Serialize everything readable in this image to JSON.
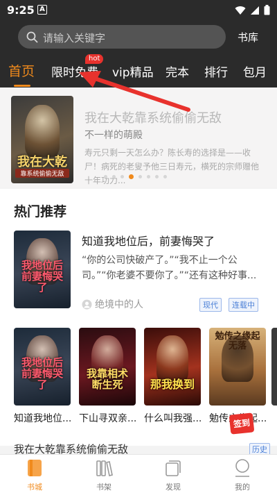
{
  "status_bar": {
    "time": "9:25",
    "badge": "A"
  },
  "search": {
    "placeholder": "请输入关键字",
    "shelf_link": "书库"
  },
  "tabs": [
    {
      "label": "首页",
      "active": true
    },
    {
      "label": "限时免费",
      "badge": "hot"
    },
    {
      "label": "vip精品"
    },
    {
      "label": "完本"
    },
    {
      "label": "排行"
    },
    {
      "label": "包月"
    }
  ],
  "banner": {
    "title": "我在大乾靠系统偷偷无敌",
    "subtitle": "不一样的萌殿",
    "desc": "寿元只剩一天怎么办？陈长寿的选择是——收尸！病死的老叟予他三日寿元，横死的宗师赠他十年功力...",
    "cover_text": "我在大乾",
    "cover_subtext": "靠系统偷偷无敌",
    "dots": 8,
    "active_dot": 4
  },
  "hot": {
    "title": "热门推荐",
    "featured": {
      "title": "知道我地位后，前妻悔哭了",
      "desc": "“你的公司快破产了。”“我不止一个公司。”“你老婆不要你了。”“还有这种好事...",
      "author": "绝境中的人",
      "tags": [
        "现代",
        "连载中"
      ],
      "cover_text": "我地位后前妻悔哭了"
    },
    "books": [
      {
        "name": "知道我地位...",
        "cover_text": "我地位后前妻悔哭了"
      },
      {
        "name": "下山寻双亲...",
        "cover_text": "我靠相术断生死"
      },
      {
        "name": "什么叫我强...",
        "cover_text": "那我换到"
      },
      {
        "name": "勉传之缘起...",
        "cover_text": "勉传之缘起无落"
      }
    ],
    "signin_badge": "签到"
  },
  "continue_reading": {
    "text": "我在大乾靠系统偷偷无敌",
    "history": "历史"
  },
  "nav": [
    {
      "label": "书城",
      "icon": "book-city-icon",
      "active": true
    },
    {
      "label": "书架",
      "icon": "bookshelf-icon"
    },
    {
      "label": "发现",
      "icon": "discover-icon"
    },
    {
      "label": "我的",
      "icon": "profile-icon"
    }
  ],
  "colors": {
    "accent": "#f08a1c",
    "header_bg": "#2b2b2b",
    "hot_badge": "#e8322d",
    "tag_blue": "#4a7fd6",
    "arrow": "#e8322d"
  }
}
